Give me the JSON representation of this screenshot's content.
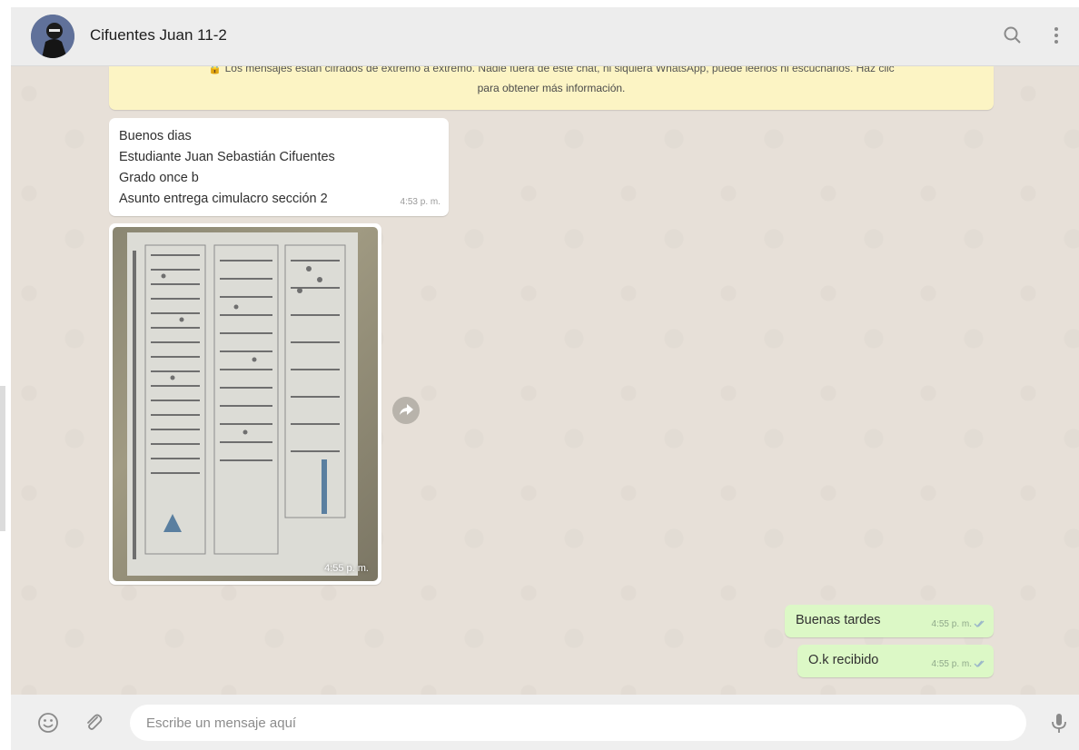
{
  "header": {
    "contact_name": "Cifuentes Juan 11-2",
    "icons": [
      "avatar",
      "search-icon",
      "menu-icon"
    ]
  },
  "banner": {
    "line1": "🔒 Los mensajes están cifrados de extremo a extremo. Nadie fuera de este chat, ni siquiera WhatsApp, puede leerlos ni escucharlos. Haz clic",
    "line2": "para obtener más información."
  },
  "messages": {
    "incoming_text": {
      "lines": [
        "Buenos dias",
        "Estudiante Juan Sebastián Cifuentes",
        "Grado once b",
        "Asunto entrega cimulacro sección 2"
      ],
      "time": "4:53 p. m."
    },
    "incoming_image": {
      "time": "4:55 p. m."
    },
    "outgoing": [
      {
        "text": "Buenas tardes",
        "time": "4:55 p. m."
      },
      {
        "text": "O.k recibido",
        "time": "4:55 p. m."
      }
    ]
  },
  "footer": {
    "placeholder": "Escribe un mensaje aquí",
    "icons": [
      "emoji-icon",
      "attach-icon",
      "mic-icon"
    ]
  },
  "colors": {
    "incoming_bubble": "#ffffff",
    "outgoing_bubble": "#dcf8c6",
    "banner": "#fcf4c4",
    "chat_bg": "#e5ddd5"
  }
}
